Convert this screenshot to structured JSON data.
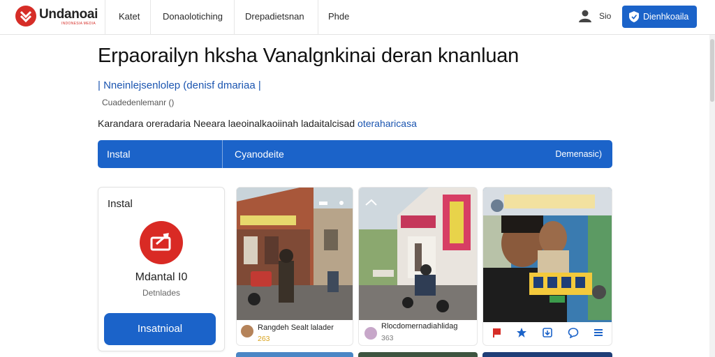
{
  "navbar": {
    "logo_text": "Undanoai",
    "logo_sub": "INDONESIA MEDIA",
    "items": [
      "Katet",
      "Donaolotiching",
      "Drepadietsnan",
      "Phde"
    ],
    "user_label": "Sio",
    "cta_label": "Dienhkoaila"
  },
  "header": {
    "title": "Erpaorailyn hksha Vanalgnkinai deran knanluan",
    "blue_subtitle": "| Nneinlejsenlolep (denisf dmariaa |",
    "gray_subtitle": "Cuadedenlemanr ()",
    "description": "Karandara oreradaria Neeara laeoinalkaoiinah ladaitalcisad",
    "description_link": "oteraharicasa"
  },
  "bluebar": {
    "left": "Instal",
    "middle": "Cyanodeite",
    "right": "Demenasic)"
  },
  "side_card": {
    "title": "Instal",
    "name": "Mdantal I0",
    "subtitle": "Detnlades",
    "button": "Insatnioal"
  },
  "cards": [
    {
      "title": "Rangdeh Sealt lalader",
      "count": "263",
      "count_color": "#d9a21b"
    },
    {
      "title": "Rlocdomernadiahlidag",
      "count": "363",
      "count_color": "#7a7a7a"
    },
    {
      "title": "",
      "count": "",
      "count_color": "#000000"
    }
  ],
  "colors": {
    "brand_blue": "#1b63c9",
    "brand_red": "#d62d27"
  }
}
